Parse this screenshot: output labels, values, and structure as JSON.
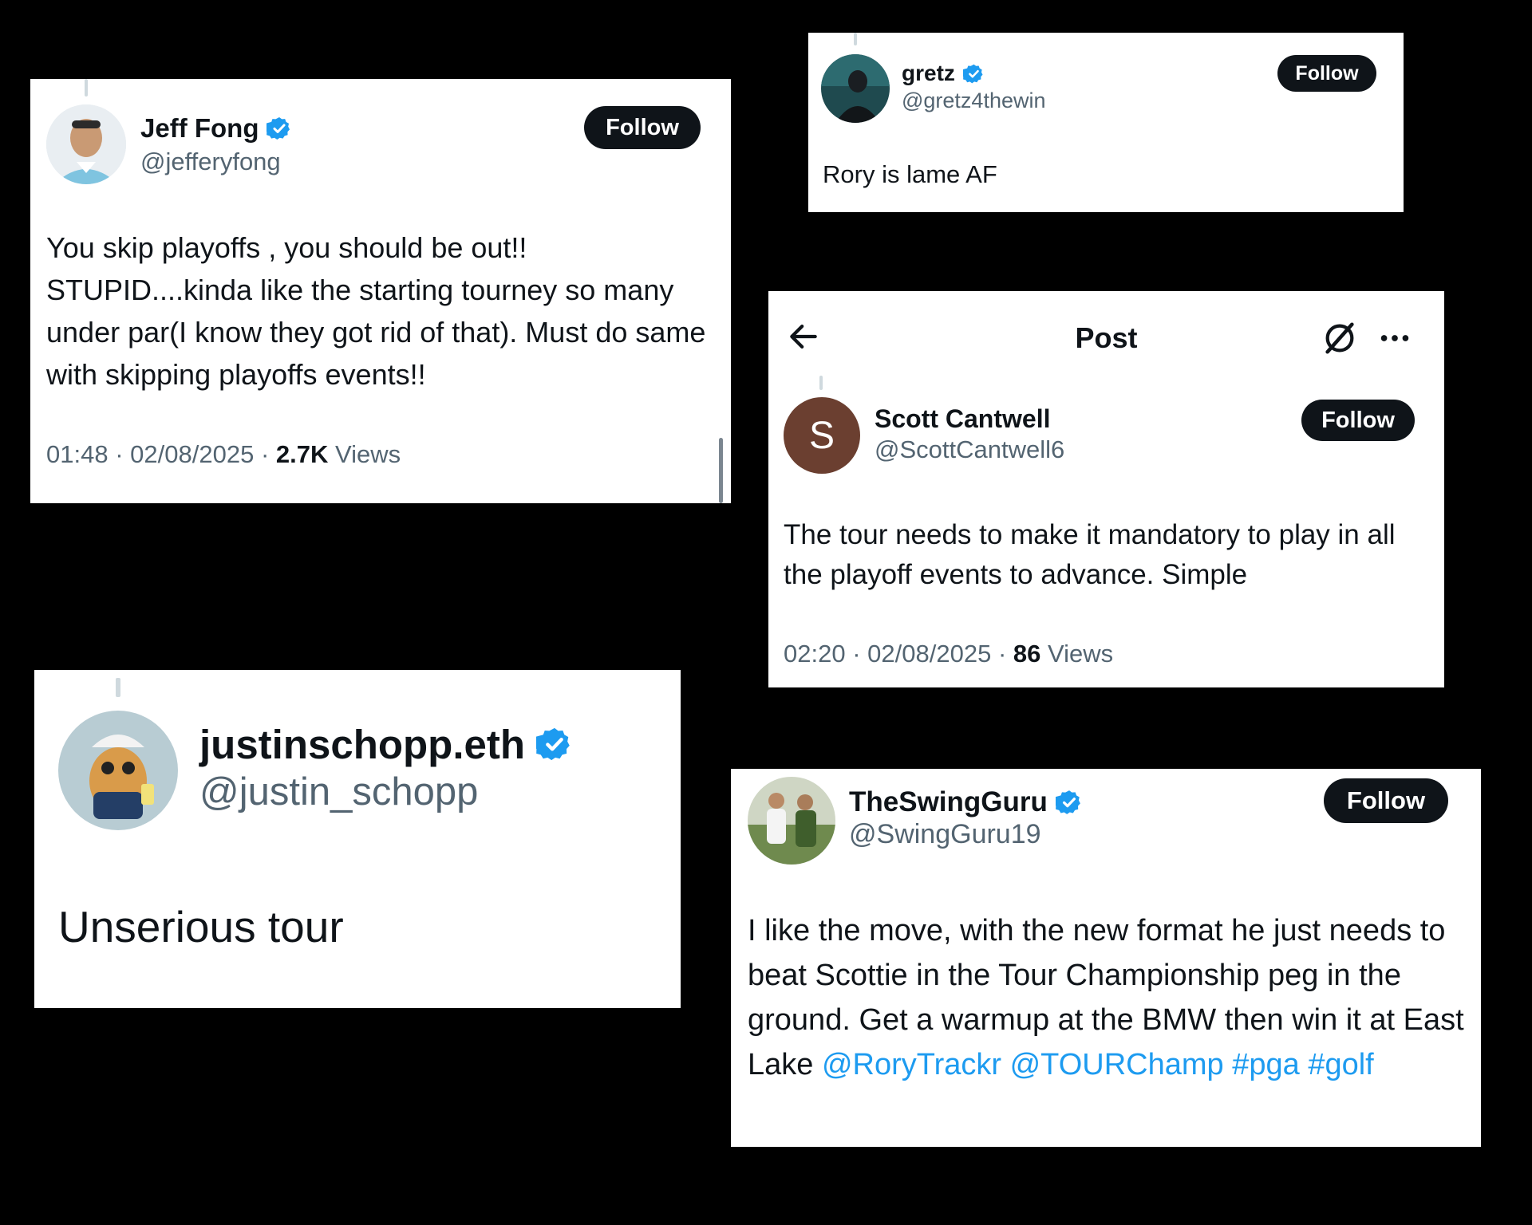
{
  "colors": {
    "background": "#000000",
    "card": "#ffffff",
    "follow_button": "#0f1419",
    "verified": "#1d9bf0",
    "link": "#1d9bf0",
    "secondary_text": "#536471"
  },
  "jeff": {
    "name": "Jeff Fong",
    "handle": "@jefferyfong",
    "follow_label": "Follow",
    "text": "You skip playoffs , you should be out!! STUPID....kinda like the starting tourney so many under par(I know they got rid of that). Must do same with skipping playoffs events!!",
    "time": "01:48",
    "date": "02/08/2025",
    "views_count": "2.7K",
    "views_label": "Views",
    "sep": "·",
    "avatar_icon": "user-photo-avatar",
    "verified_icon": "verified-badge-icon"
  },
  "gretz": {
    "name": "gretz",
    "handle": "@gretz4thewin",
    "follow_label": "Follow",
    "text": "Rory is lame AF",
    "avatar_icon": "user-photo-avatar",
    "verified_icon": "verified-badge-icon"
  },
  "scott": {
    "header_title": "Post",
    "back_icon": "arrow-left-icon",
    "grok_icon": "grok-icon",
    "more_icon": "more-dots-icon",
    "avatar_letter": "S",
    "name": "Scott Cantwell",
    "handle": "@ScottCantwell6",
    "follow_label": "Follow",
    "text": "The tour needs to make it mandatory to play in all the playoff events to advance. Simple",
    "time": "02:20",
    "date": "02/08/2025",
    "views_count": "86",
    "views_label": "Views",
    "sep": "·"
  },
  "justin": {
    "name": "justinschopp.eth",
    "handle": "@justin_schopp",
    "text": "Unserious tour",
    "avatar_icon": "cartoon-character-avatar",
    "verified_icon": "verified-badge-icon"
  },
  "swing": {
    "name": "TheSwingGuru",
    "handle": "@SwingGuru19",
    "follow_label": "Follow",
    "text_plain": "I like the move, with the new format he just needs to beat Scottie in the Tour Championship peg in the ground. Get a warmup at the BMW then win it at East Lake",
    "mention1": "@RoryTrackr",
    "mention2": "@TOURChamp",
    "hashtag1": "#pga",
    "hashtag2": "#golf",
    "avatar_icon": "golfers-photo-avatar",
    "verified_icon": "verified-badge-icon"
  }
}
